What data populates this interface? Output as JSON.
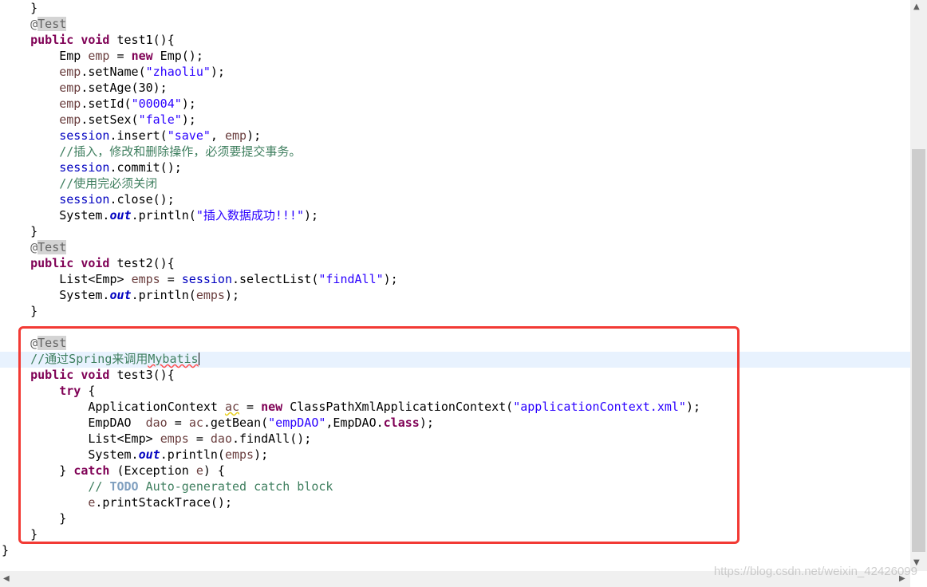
{
  "lines": [
    [
      {
        "t": "    }"
      }
    ],
    [
      {
        "t": "    "
      },
      {
        "t": "@",
        "c": "ann"
      },
      {
        "t": "Test",
        "c": "annbox"
      }
    ],
    [
      {
        "t": "    "
      },
      {
        "t": "public",
        "c": "kw"
      },
      {
        "t": " "
      },
      {
        "t": "void",
        "c": "kw"
      },
      {
        "t": " test1(){"
      }
    ],
    [
      {
        "t": "        Emp "
      },
      {
        "t": "emp",
        "c": "loc"
      },
      {
        "t": " = "
      },
      {
        "t": "new",
        "c": "kw"
      },
      {
        "t": " Emp();"
      }
    ],
    [
      {
        "t": "        "
      },
      {
        "t": "emp",
        "c": "loc"
      },
      {
        "t": ".setName("
      },
      {
        "t": "\"zhaoliu\"",
        "c": "str"
      },
      {
        "t": ");"
      }
    ],
    [
      {
        "t": "        "
      },
      {
        "t": "emp",
        "c": "loc"
      },
      {
        "t": ".setAge(30);"
      }
    ],
    [
      {
        "t": "        "
      },
      {
        "t": "emp",
        "c": "loc"
      },
      {
        "t": ".setId("
      },
      {
        "t": "\"00004\"",
        "c": "str"
      },
      {
        "t": ");"
      }
    ],
    [
      {
        "t": "        "
      },
      {
        "t": "emp",
        "c": "loc"
      },
      {
        "t": ".setSex("
      },
      {
        "t": "\"fale\"",
        "c": "str"
      },
      {
        "t": ");"
      }
    ],
    [
      {
        "t": "        "
      },
      {
        "t": "session",
        "c": "fld"
      },
      {
        "t": ".insert("
      },
      {
        "t": "\"save\"",
        "c": "str"
      },
      {
        "t": ", "
      },
      {
        "t": "emp",
        "c": "loc"
      },
      {
        "t": ");"
      }
    ],
    [
      {
        "t": "        "
      },
      {
        "t": "//插入，修改和删除操作，必须要提交事务。",
        "c": "com"
      }
    ],
    [
      {
        "t": "        "
      },
      {
        "t": "session",
        "c": "fld"
      },
      {
        "t": ".commit();"
      }
    ],
    [
      {
        "t": "        "
      },
      {
        "t": "//使用完必须关闭",
        "c": "com"
      }
    ],
    [
      {
        "t": "        "
      },
      {
        "t": "session",
        "c": "fld"
      },
      {
        "t": ".close();"
      }
    ],
    [
      {
        "t": "        System."
      },
      {
        "t": "out",
        "c": "static"
      },
      {
        "t": ".println("
      },
      {
        "t": "\"插入数据成功!!!\"",
        "c": "str"
      },
      {
        "t": ");"
      }
    ],
    [
      {
        "t": "    }"
      }
    ],
    [
      {
        "t": "    "
      },
      {
        "t": "@",
        "c": "ann"
      },
      {
        "t": "Test",
        "c": "annbox"
      }
    ],
    [
      {
        "t": "    "
      },
      {
        "t": "public",
        "c": "kw"
      },
      {
        "t": " "
      },
      {
        "t": "void",
        "c": "kw"
      },
      {
        "t": " test2(){"
      }
    ],
    [
      {
        "t": "        List<Emp> "
      },
      {
        "t": "emps",
        "c": "loc"
      },
      {
        "t": " = "
      },
      {
        "t": "session",
        "c": "fld"
      },
      {
        "t": ".selectList("
      },
      {
        "t": "\"findAll\"",
        "c": "str"
      },
      {
        "t": ");"
      }
    ],
    [
      {
        "t": "        System."
      },
      {
        "t": "out",
        "c": "static"
      },
      {
        "t": ".println("
      },
      {
        "t": "emps",
        "c": "loc"
      },
      {
        "t": ");"
      }
    ],
    [
      {
        "t": "    }"
      }
    ],
    [
      {
        "t": ""
      }
    ],
    [
      {
        "t": "    "
      },
      {
        "t": "@",
        "c": "ann"
      },
      {
        "t": "Test",
        "c": "annbox"
      }
    ],
    [
      {
        "t": "    "
      },
      {
        "t": "//通过Spring来调用",
        "c": "com"
      },
      {
        "t": "Mybatis",
        "c": "com sqr"
      },
      {
        "caret": true
      }
    ],
    [
      {
        "t": "    "
      },
      {
        "t": "public",
        "c": "kw"
      },
      {
        "t": " "
      },
      {
        "t": "void",
        "c": "kw"
      },
      {
        "t": " test3(){"
      }
    ],
    [
      {
        "t": "        "
      },
      {
        "t": "try",
        "c": "kw"
      },
      {
        "t": " {"
      }
    ],
    [
      {
        "t": "            ApplicationContext "
      },
      {
        "t": "ac",
        "c": "loc sq"
      },
      {
        "t": " = "
      },
      {
        "t": "new",
        "c": "kw"
      },
      {
        "t": " ClassPathXmlApplicationContext("
      },
      {
        "t": "\"applicationContext.xml\"",
        "c": "str"
      },
      {
        "t": ");"
      }
    ],
    [
      {
        "t": "            EmpDAO  "
      },
      {
        "t": "dao",
        "c": "loc"
      },
      {
        "t": " = "
      },
      {
        "t": "ac",
        "c": "loc"
      },
      {
        "t": ".getBean("
      },
      {
        "t": "\"empDAO\"",
        "c": "str"
      },
      {
        "t": ",EmpDAO."
      },
      {
        "t": "class",
        "c": "kw"
      },
      {
        "t": ");"
      }
    ],
    [
      {
        "t": "            List<Emp> "
      },
      {
        "t": "emps",
        "c": "loc"
      },
      {
        "t": " = "
      },
      {
        "t": "dao",
        "c": "loc"
      },
      {
        "t": ".findAll();"
      }
    ],
    [
      {
        "t": "            System."
      },
      {
        "t": "out",
        "c": "static"
      },
      {
        "t": ".println("
      },
      {
        "t": "emps",
        "c": "loc"
      },
      {
        "t": ");"
      }
    ],
    [
      {
        "t": "        } "
      },
      {
        "t": "catch",
        "c": "kw"
      },
      {
        "t": " (Exception "
      },
      {
        "t": "e",
        "c": "loc"
      },
      {
        "t": ") {"
      }
    ],
    [
      {
        "t": "            "
      },
      {
        "t": "// ",
        "c": "com"
      },
      {
        "t": "TODO",
        "c": "todo"
      },
      {
        "t": " Auto-generated catch block",
        "c": "com"
      }
    ],
    [
      {
        "t": "            "
      },
      {
        "t": "e",
        "c": "loc"
      },
      {
        "t": ".printStackTrace();"
      }
    ],
    [
      {
        "t": "        }"
      }
    ],
    [
      {
        "t": "    }"
      }
    ],
    [
      {
        "t": "}"
      }
    ]
  ],
  "scroll_up_arrow": "▲",
  "scroll_down_arrow": "▼",
  "scroll_left_arrow": "◀",
  "scroll_right_arrow": "▶",
  "watermark": "https://blog.csdn.net/weixin_42426099"
}
